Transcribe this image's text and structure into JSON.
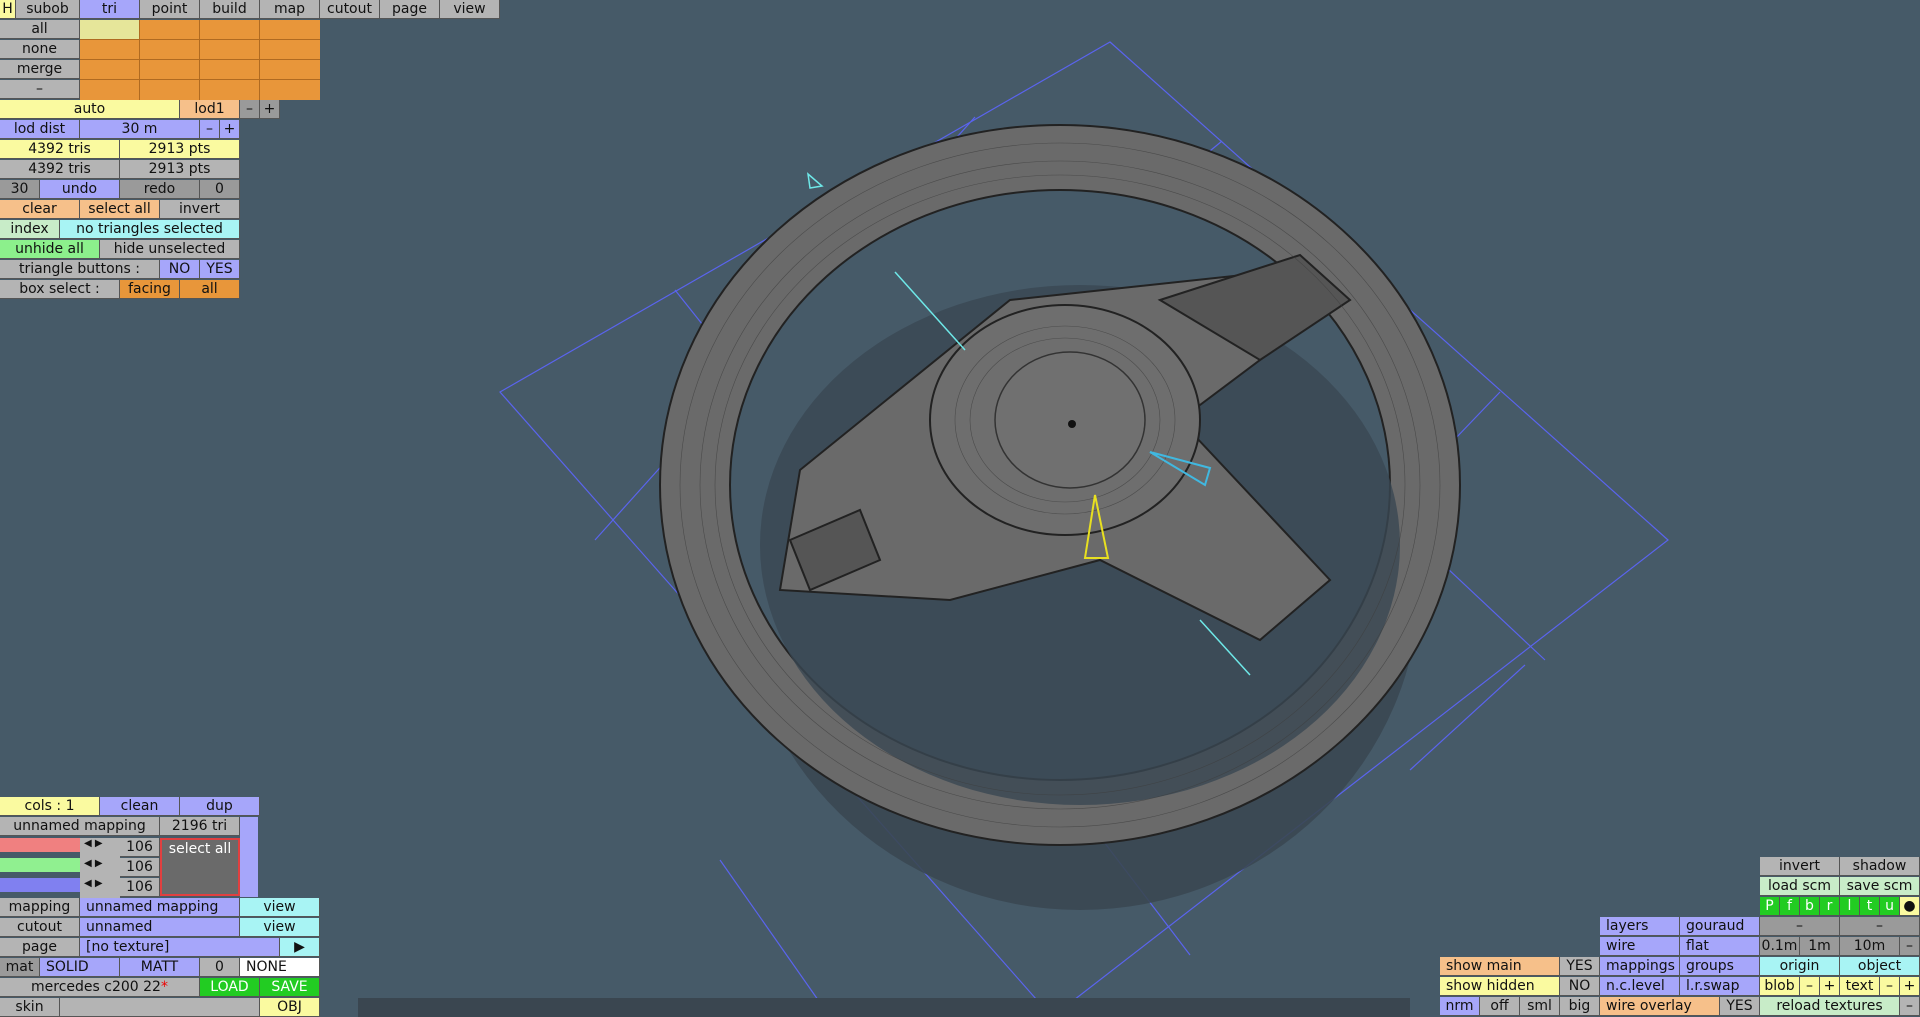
{
  "menu": [
    "subob",
    "tri",
    "point",
    "build",
    "map",
    "cutout",
    "page",
    "view"
  ],
  "menu_h": "H",
  "sel_rows": [
    "all",
    "none",
    "merge",
    "–"
  ],
  "lod": {
    "auto": "auto",
    "name": "lod1",
    "minus": "–",
    "plus": "+",
    "dist_label": "lod dist",
    "dist_value": "30 m",
    "dist_minus": "–",
    "dist_plus": "+"
  },
  "stats": [
    {
      "tris": "4392 tris",
      "pts": "2913 pts"
    },
    {
      "tris": "4392 tris",
      "pts": "2913 pts"
    }
  ],
  "undo": {
    "count": "30",
    "undo": "undo",
    "redo": "redo",
    "redo_count": "0"
  },
  "selection": {
    "clear": "clear",
    "select_all": "select all",
    "invert": "invert",
    "index": "index",
    "status": "no triangles selected",
    "unhide_all": "unhide all",
    "hide_unselected": "hide unselected",
    "tri_buttons": "triangle buttons :",
    "no": "NO",
    "yes": "YES",
    "box_select": "box select :",
    "facing": "facing",
    "all": "all"
  },
  "mapping_panel": {
    "cols": "cols : 1",
    "clean": "clean",
    "dup": "dup",
    "mapping_name": "unnamed mapping",
    "tri_count": "2196 tri",
    "channels": [
      "106",
      "106",
      "106"
    ],
    "select_all": "select all",
    "mapping_label": "mapping",
    "mapping_value": "unnamed mapping",
    "view": "view",
    "cutout_label": "cutout",
    "cutout_value": "unnamed",
    "page_label": "page",
    "page_value": "[no texture]",
    "mat": "mat",
    "solid": "SOLID",
    "matt": "MATT",
    "mat_num": "0",
    "none": "NONE",
    "model_name": "mercedes c200 22",
    "load": "LOAD",
    "save": "SAVE",
    "skin": "skin",
    "obj": "OBJ"
  },
  "right_panel": {
    "invert": "invert",
    "shadow": "shadow",
    "load_scm": "load scm",
    "save_scm": "save scm",
    "pfbrltu": [
      "P",
      "f",
      "b",
      "r",
      "l",
      "t",
      "u"
    ],
    "layers": "layers",
    "gouraud": "gouraud",
    "wire": "wire",
    "flat": "flat",
    "s01": "0.1m",
    "s1": "1m",
    "s10": "10m",
    "show_main": "show main",
    "show_main_val": "YES",
    "mappings": "mappings",
    "groups": "groups",
    "origin": "origin",
    "object": "object",
    "show_hidden": "show hidden",
    "show_hidden_val": "NO",
    "nclevel": "n.c.level",
    "lrswap": "l.r.swap",
    "blob": "blob",
    "text": "text",
    "nrm": "nrm",
    "off": "off",
    "sml": "sml",
    "big": "big",
    "wire_overlay": "wire overlay",
    "wire_overlay_val": "YES",
    "reload": "reload textures",
    "dash": "–"
  },
  "colors": {
    "background": "#465a68",
    "blue_button": "#a6a6fa",
    "yellow_button": "#fafaa0",
    "orange_button": "#e8963a"
  }
}
